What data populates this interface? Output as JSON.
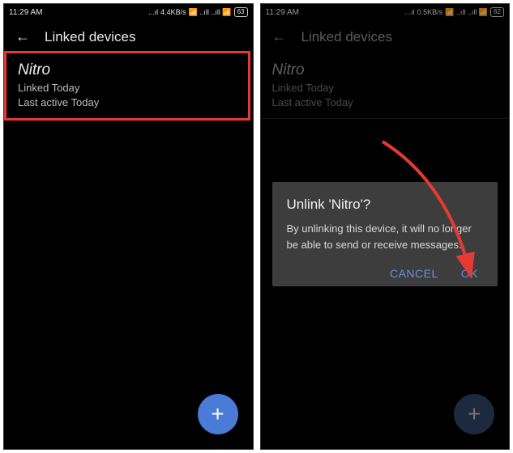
{
  "left": {
    "statusbar": {
      "time": "11:29 AM",
      "net": "4.4KB/s",
      "battery": "63"
    },
    "header": {
      "title": "Linked devices"
    },
    "device": {
      "name": "Nitro",
      "linked": "Linked Today",
      "active": "Last active Today"
    },
    "fab": "+"
  },
  "right": {
    "statusbar": {
      "time": "11:29 AM",
      "net": "0.5KB/s",
      "battery": "62"
    },
    "header": {
      "title": "Linked devices"
    },
    "device": {
      "name": "Nitro",
      "linked": "Linked Today",
      "active": "Last active Today"
    },
    "dialog": {
      "title": "Unlink 'Nitro'?",
      "message": "By unlinking this device, it will no longer be able to send or receive messages.",
      "cancel": "CANCEL",
      "ok": "OK"
    },
    "fab": "+"
  }
}
